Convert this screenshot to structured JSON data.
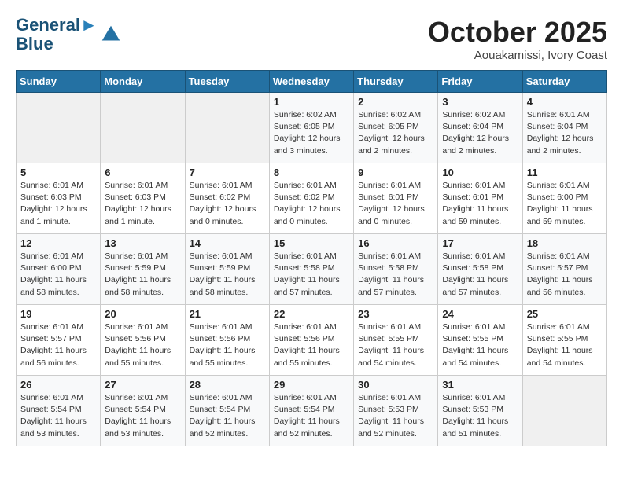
{
  "header": {
    "logo_line1": "General",
    "logo_line2": "Blue",
    "month": "October 2025",
    "location": "Aouakamissi, Ivory Coast"
  },
  "weekdays": [
    "Sunday",
    "Monday",
    "Tuesday",
    "Wednesday",
    "Thursday",
    "Friday",
    "Saturday"
  ],
  "weeks": [
    [
      {
        "day": "",
        "info": ""
      },
      {
        "day": "",
        "info": ""
      },
      {
        "day": "",
        "info": ""
      },
      {
        "day": "1",
        "info": "Sunrise: 6:02 AM\nSunset: 6:05 PM\nDaylight: 12 hours\nand 3 minutes."
      },
      {
        "day": "2",
        "info": "Sunrise: 6:02 AM\nSunset: 6:05 PM\nDaylight: 12 hours\nand 2 minutes."
      },
      {
        "day": "3",
        "info": "Sunrise: 6:02 AM\nSunset: 6:04 PM\nDaylight: 12 hours\nand 2 minutes."
      },
      {
        "day": "4",
        "info": "Sunrise: 6:01 AM\nSunset: 6:04 PM\nDaylight: 12 hours\nand 2 minutes."
      }
    ],
    [
      {
        "day": "5",
        "info": "Sunrise: 6:01 AM\nSunset: 6:03 PM\nDaylight: 12 hours\nand 1 minute."
      },
      {
        "day": "6",
        "info": "Sunrise: 6:01 AM\nSunset: 6:03 PM\nDaylight: 12 hours\nand 1 minute."
      },
      {
        "day": "7",
        "info": "Sunrise: 6:01 AM\nSunset: 6:02 PM\nDaylight: 12 hours\nand 0 minutes."
      },
      {
        "day": "8",
        "info": "Sunrise: 6:01 AM\nSunset: 6:02 PM\nDaylight: 12 hours\nand 0 minutes."
      },
      {
        "day": "9",
        "info": "Sunrise: 6:01 AM\nSunset: 6:01 PM\nDaylight: 12 hours\nand 0 minutes."
      },
      {
        "day": "10",
        "info": "Sunrise: 6:01 AM\nSunset: 6:01 PM\nDaylight: 11 hours\nand 59 minutes."
      },
      {
        "day": "11",
        "info": "Sunrise: 6:01 AM\nSunset: 6:00 PM\nDaylight: 11 hours\nand 59 minutes."
      }
    ],
    [
      {
        "day": "12",
        "info": "Sunrise: 6:01 AM\nSunset: 6:00 PM\nDaylight: 11 hours\nand 58 minutes."
      },
      {
        "day": "13",
        "info": "Sunrise: 6:01 AM\nSunset: 5:59 PM\nDaylight: 11 hours\nand 58 minutes."
      },
      {
        "day": "14",
        "info": "Sunrise: 6:01 AM\nSunset: 5:59 PM\nDaylight: 11 hours\nand 58 minutes."
      },
      {
        "day": "15",
        "info": "Sunrise: 6:01 AM\nSunset: 5:58 PM\nDaylight: 11 hours\nand 57 minutes."
      },
      {
        "day": "16",
        "info": "Sunrise: 6:01 AM\nSunset: 5:58 PM\nDaylight: 11 hours\nand 57 minutes."
      },
      {
        "day": "17",
        "info": "Sunrise: 6:01 AM\nSunset: 5:58 PM\nDaylight: 11 hours\nand 57 minutes."
      },
      {
        "day": "18",
        "info": "Sunrise: 6:01 AM\nSunset: 5:57 PM\nDaylight: 11 hours\nand 56 minutes."
      }
    ],
    [
      {
        "day": "19",
        "info": "Sunrise: 6:01 AM\nSunset: 5:57 PM\nDaylight: 11 hours\nand 56 minutes."
      },
      {
        "day": "20",
        "info": "Sunrise: 6:01 AM\nSunset: 5:56 PM\nDaylight: 11 hours\nand 55 minutes."
      },
      {
        "day": "21",
        "info": "Sunrise: 6:01 AM\nSunset: 5:56 PM\nDaylight: 11 hours\nand 55 minutes."
      },
      {
        "day": "22",
        "info": "Sunrise: 6:01 AM\nSunset: 5:56 PM\nDaylight: 11 hours\nand 55 minutes."
      },
      {
        "day": "23",
        "info": "Sunrise: 6:01 AM\nSunset: 5:55 PM\nDaylight: 11 hours\nand 54 minutes."
      },
      {
        "day": "24",
        "info": "Sunrise: 6:01 AM\nSunset: 5:55 PM\nDaylight: 11 hours\nand 54 minutes."
      },
      {
        "day": "25",
        "info": "Sunrise: 6:01 AM\nSunset: 5:55 PM\nDaylight: 11 hours\nand 54 minutes."
      }
    ],
    [
      {
        "day": "26",
        "info": "Sunrise: 6:01 AM\nSunset: 5:54 PM\nDaylight: 11 hours\nand 53 minutes."
      },
      {
        "day": "27",
        "info": "Sunrise: 6:01 AM\nSunset: 5:54 PM\nDaylight: 11 hours\nand 53 minutes."
      },
      {
        "day": "28",
        "info": "Sunrise: 6:01 AM\nSunset: 5:54 PM\nDaylight: 11 hours\nand 52 minutes."
      },
      {
        "day": "29",
        "info": "Sunrise: 6:01 AM\nSunset: 5:54 PM\nDaylight: 11 hours\nand 52 minutes."
      },
      {
        "day": "30",
        "info": "Sunrise: 6:01 AM\nSunset: 5:53 PM\nDaylight: 11 hours\nand 52 minutes."
      },
      {
        "day": "31",
        "info": "Sunrise: 6:01 AM\nSunset: 5:53 PM\nDaylight: 11 hours\nand 51 minutes."
      },
      {
        "day": "",
        "info": ""
      }
    ]
  ]
}
